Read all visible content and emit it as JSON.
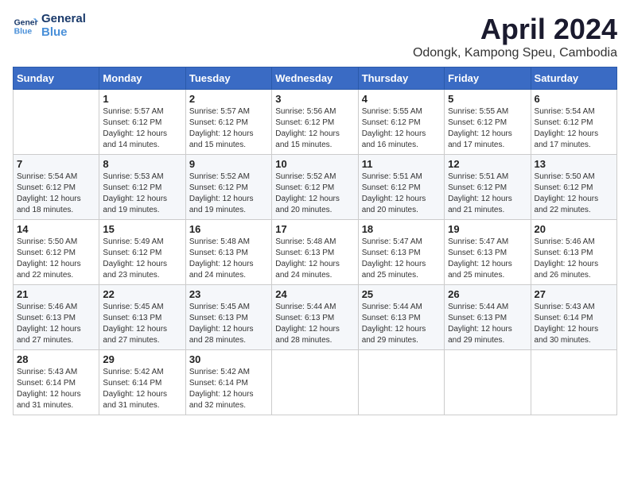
{
  "logo": {
    "line1": "General",
    "line2": "Blue"
  },
  "title": "April 2024",
  "location": "Odongk, Kampong Speu, Cambodia",
  "days_header": [
    "Sunday",
    "Monday",
    "Tuesday",
    "Wednesday",
    "Thursday",
    "Friday",
    "Saturday"
  ],
  "weeks": [
    [
      {
        "day": "",
        "sunrise": "",
        "sunset": "",
        "daylight": ""
      },
      {
        "day": "1",
        "sunrise": "Sunrise: 5:57 AM",
        "sunset": "Sunset: 6:12 PM",
        "daylight": "Daylight: 12 hours and 14 minutes."
      },
      {
        "day": "2",
        "sunrise": "Sunrise: 5:57 AM",
        "sunset": "Sunset: 6:12 PM",
        "daylight": "Daylight: 12 hours and 15 minutes."
      },
      {
        "day": "3",
        "sunrise": "Sunrise: 5:56 AM",
        "sunset": "Sunset: 6:12 PM",
        "daylight": "Daylight: 12 hours and 15 minutes."
      },
      {
        "day": "4",
        "sunrise": "Sunrise: 5:55 AM",
        "sunset": "Sunset: 6:12 PM",
        "daylight": "Daylight: 12 hours and 16 minutes."
      },
      {
        "day": "5",
        "sunrise": "Sunrise: 5:55 AM",
        "sunset": "Sunset: 6:12 PM",
        "daylight": "Daylight: 12 hours and 17 minutes."
      },
      {
        "day": "6",
        "sunrise": "Sunrise: 5:54 AM",
        "sunset": "Sunset: 6:12 PM",
        "daylight": "Daylight: 12 hours and 17 minutes."
      }
    ],
    [
      {
        "day": "7",
        "sunrise": "Sunrise: 5:54 AM",
        "sunset": "Sunset: 6:12 PM",
        "daylight": "Daylight: 12 hours and 18 minutes."
      },
      {
        "day": "8",
        "sunrise": "Sunrise: 5:53 AM",
        "sunset": "Sunset: 6:12 PM",
        "daylight": "Daylight: 12 hours and 19 minutes."
      },
      {
        "day": "9",
        "sunrise": "Sunrise: 5:52 AM",
        "sunset": "Sunset: 6:12 PM",
        "daylight": "Daylight: 12 hours and 19 minutes."
      },
      {
        "day": "10",
        "sunrise": "Sunrise: 5:52 AM",
        "sunset": "Sunset: 6:12 PM",
        "daylight": "Daylight: 12 hours and 20 minutes."
      },
      {
        "day": "11",
        "sunrise": "Sunrise: 5:51 AM",
        "sunset": "Sunset: 6:12 PM",
        "daylight": "Daylight: 12 hours and 20 minutes."
      },
      {
        "day": "12",
        "sunrise": "Sunrise: 5:51 AM",
        "sunset": "Sunset: 6:12 PM",
        "daylight": "Daylight: 12 hours and 21 minutes."
      },
      {
        "day": "13",
        "sunrise": "Sunrise: 5:50 AM",
        "sunset": "Sunset: 6:12 PM",
        "daylight": "Daylight: 12 hours and 22 minutes."
      }
    ],
    [
      {
        "day": "14",
        "sunrise": "Sunrise: 5:50 AM",
        "sunset": "Sunset: 6:12 PM",
        "daylight": "Daylight: 12 hours and 22 minutes."
      },
      {
        "day": "15",
        "sunrise": "Sunrise: 5:49 AM",
        "sunset": "Sunset: 6:12 PM",
        "daylight": "Daylight: 12 hours and 23 minutes."
      },
      {
        "day": "16",
        "sunrise": "Sunrise: 5:48 AM",
        "sunset": "Sunset: 6:13 PM",
        "daylight": "Daylight: 12 hours and 24 minutes."
      },
      {
        "day": "17",
        "sunrise": "Sunrise: 5:48 AM",
        "sunset": "Sunset: 6:13 PM",
        "daylight": "Daylight: 12 hours and 24 minutes."
      },
      {
        "day": "18",
        "sunrise": "Sunrise: 5:47 AM",
        "sunset": "Sunset: 6:13 PM",
        "daylight": "Daylight: 12 hours and 25 minutes."
      },
      {
        "day": "19",
        "sunrise": "Sunrise: 5:47 AM",
        "sunset": "Sunset: 6:13 PM",
        "daylight": "Daylight: 12 hours and 25 minutes."
      },
      {
        "day": "20",
        "sunrise": "Sunrise: 5:46 AM",
        "sunset": "Sunset: 6:13 PM",
        "daylight": "Daylight: 12 hours and 26 minutes."
      }
    ],
    [
      {
        "day": "21",
        "sunrise": "Sunrise: 5:46 AM",
        "sunset": "Sunset: 6:13 PM",
        "daylight": "Daylight: 12 hours and 27 minutes."
      },
      {
        "day": "22",
        "sunrise": "Sunrise: 5:45 AM",
        "sunset": "Sunset: 6:13 PM",
        "daylight": "Daylight: 12 hours and 27 minutes."
      },
      {
        "day": "23",
        "sunrise": "Sunrise: 5:45 AM",
        "sunset": "Sunset: 6:13 PM",
        "daylight": "Daylight: 12 hours and 28 minutes."
      },
      {
        "day": "24",
        "sunrise": "Sunrise: 5:44 AM",
        "sunset": "Sunset: 6:13 PM",
        "daylight": "Daylight: 12 hours and 28 minutes."
      },
      {
        "day": "25",
        "sunrise": "Sunrise: 5:44 AM",
        "sunset": "Sunset: 6:13 PM",
        "daylight": "Daylight: 12 hours and 29 minutes."
      },
      {
        "day": "26",
        "sunrise": "Sunrise: 5:44 AM",
        "sunset": "Sunset: 6:13 PM",
        "daylight": "Daylight: 12 hours and 29 minutes."
      },
      {
        "day": "27",
        "sunrise": "Sunrise: 5:43 AM",
        "sunset": "Sunset: 6:14 PM",
        "daylight": "Daylight: 12 hours and 30 minutes."
      }
    ],
    [
      {
        "day": "28",
        "sunrise": "Sunrise: 5:43 AM",
        "sunset": "Sunset: 6:14 PM",
        "daylight": "Daylight: 12 hours and 31 minutes."
      },
      {
        "day": "29",
        "sunrise": "Sunrise: 5:42 AM",
        "sunset": "Sunset: 6:14 PM",
        "daylight": "Daylight: 12 hours and 31 minutes."
      },
      {
        "day": "30",
        "sunrise": "Sunrise: 5:42 AM",
        "sunset": "Sunset: 6:14 PM",
        "daylight": "Daylight: 12 hours and 32 minutes."
      },
      {
        "day": "",
        "sunrise": "",
        "sunset": "",
        "daylight": ""
      },
      {
        "day": "",
        "sunrise": "",
        "sunset": "",
        "daylight": ""
      },
      {
        "day": "",
        "sunrise": "",
        "sunset": "",
        "daylight": ""
      },
      {
        "day": "",
        "sunrise": "",
        "sunset": "",
        "daylight": ""
      }
    ]
  ]
}
